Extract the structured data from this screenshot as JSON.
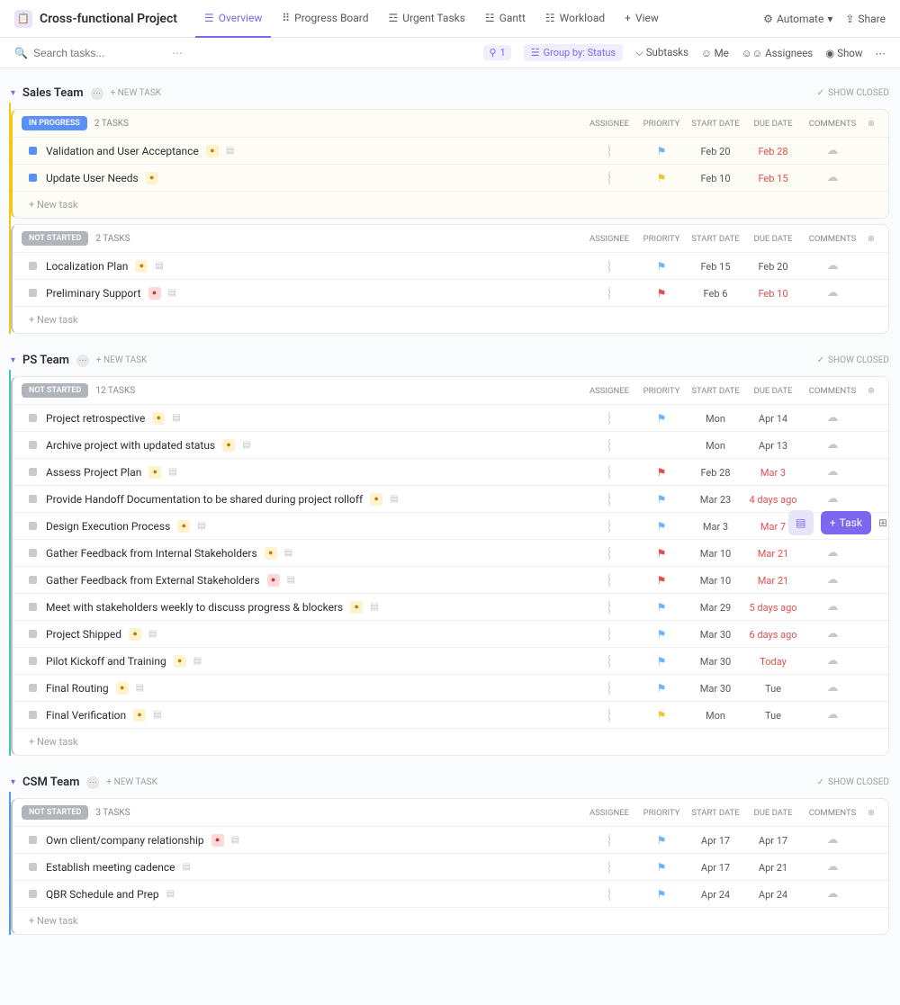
{
  "header": {
    "project_title": "Cross-functional Project",
    "tabs": [
      "Overview",
      "Progress Board",
      "Urgent Tasks",
      "Gantt",
      "Workload"
    ],
    "view": "View",
    "automate": "Automate",
    "share": "Share"
  },
  "toolbar": {
    "search_ph": "Search tasks...",
    "filter_count": "1",
    "group_label": "Group by: Status",
    "subtasks": "Subtasks",
    "me": "Me",
    "assignees": "Assignees",
    "show": "Show"
  },
  "common": {
    "new_task_caps": "+ NEW TASK",
    "new_task": "+ New task",
    "show_closed": "SHOW CLOSED",
    "cols": {
      "assignee": "ASSIGNEE",
      "priority": "PRIORITY",
      "start": "START DATE",
      "due": "DUE DATE",
      "comments": "COMMENTS"
    }
  },
  "sections": [
    {
      "name": "Sales Team",
      "accent": "yellow",
      "groups": [
        {
          "status": "IN PROGRESS",
          "pill": "pill-progress",
          "mk": "mk-progress",
          "count": "2 TASKS",
          "card": "yellow",
          "tasks": [
            {
              "name": "Validation and User Acceptance",
              "tag": "y",
              "desc": true,
              "prio": "blue",
              "start": "Feb 20",
              "due": "Feb 28",
              "due_red": true
            },
            {
              "name": "Update User Needs",
              "tag": "y",
              "desc": false,
              "prio": "yellow",
              "start": "Feb 10",
              "due": "Feb 15",
              "due_red": true
            }
          ]
        },
        {
          "status": "NOT STARTED",
          "pill": "pill-notstarted",
          "mk": "mk-notstarted",
          "count": "2 TASKS",
          "card": "gray",
          "tasks": [
            {
              "name": "Localization Plan",
              "tag": "y",
              "desc": true,
              "prio": "blue",
              "start": "Feb 15",
              "due": "Feb 20",
              "due_red": false
            },
            {
              "name": "Preliminary Support",
              "tag": "r",
              "desc": true,
              "prio": "red",
              "start": "Feb 6",
              "due": "Feb 10",
              "due_red": true
            }
          ]
        }
      ]
    },
    {
      "name": "PS Team",
      "accent": "teal",
      "groups": [
        {
          "status": "NOT STARTED",
          "pill": "pill-notstarted",
          "mk": "mk-notstarted",
          "count": "12 TASKS",
          "card": "gray",
          "tasks": [
            {
              "name": "Project retrospective",
              "tag": "y",
              "desc": true,
              "prio": "blue",
              "start": "Mon",
              "due": "Apr 14",
              "due_red": false
            },
            {
              "name": "Archive project with updated status",
              "tag": "y",
              "desc": true,
              "prio": "",
              "start": "Mon",
              "due": "Apr 13",
              "due_red": false
            },
            {
              "name": "Assess Project Plan",
              "tag": "y",
              "desc": true,
              "prio": "red",
              "start": "Feb 28",
              "due": "Mar 3",
              "due_red": true
            },
            {
              "name": "Provide Handoff Documentation to be shared during project rolloff",
              "tag": "y",
              "desc": true,
              "prio": "blue",
              "start": "Mar 23",
              "due": "4 days ago",
              "due_red": true
            },
            {
              "name": "Design Execution Process",
              "tag": "y",
              "desc": true,
              "prio": "blue",
              "start": "Mar 3",
              "due": "Mar 7",
              "due_red": true
            },
            {
              "name": "Gather Feedback from Internal Stakeholders",
              "tag": "y",
              "desc": true,
              "prio": "red",
              "start": "Mar 10",
              "due": "Mar 21",
              "due_red": true
            },
            {
              "name": "Gather Feedback from External Stakeholders",
              "tag": "r",
              "desc": true,
              "prio": "red",
              "start": "Mar 10",
              "due": "Mar 21",
              "due_red": true
            },
            {
              "name": "Meet with stakeholders weekly to discuss progress & blockers",
              "tag": "y",
              "desc": true,
              "prio": "blue",
              "start": "Mar 29",
              "due": "5 days ago",
              "due_red": true
            },
            {
              "name": "Project Shipped",
              "tag": "y",
              "desc": true,
              "prio": "blue",
              "start": "Mar 30",
              "due": "6 days ago",
              "due_red": true
            },
            {
              "name": "Pilot Kickoff and Training",
              "tag": "y",
              "desc": true,
              "prio": "blue",
              "start": "Mar 30",
              "due": "Today",
              "due_red": true
            },
            {
              "name": "Final Routing",
              "tag": "y",
              "desc": true,
              "prio": "blue",
              "start": "Mar 30",
              "due": "Tue",
              "due_red": false
            },
            {
              "name": "Final Verification",
              "tag": "y",
              "desc": true,
              "prio": "yellow",
              "start": "Mon",
              "due": "Tue",
              "due_red": false
            }
          ]
        }
      ]
    },
    {
      "name": "CSM Team",
      "accent": "blue",
      "groups": [
        {
          "status": "NOT STARTED",
          "pill": "pill-notstarted",
          "mk": "mk-notstarted",
          "count": "3 TASKS",
          "card": "gray",
          "tasks": [
            {
              "name": "Own client/company relationship",
              "tag": "r",
              "desc": true,
              "prio": "blue",
              "start": "Apr 17",
              "due": "Apr 17",
              "due_red": false
            },
            {
              "name": "Establish meeting cadence",
              "tag": "",
              "desc": true,
              "prio": "blue",
              "start": "Apr 17",
              "due": "Apr 21",
              "due_red": false
            },
            {
              "name": "QBR Schedule and Prep",
              "tag": "",
              "desc": true,
              "prio": "blue",
              "start": "Apr 24",
              "due": "Apr 24",
              "due_red": false
            }
          ]
        }
      ]
    }
  ],
  "float": {
    "task": "Task"
  }
}
